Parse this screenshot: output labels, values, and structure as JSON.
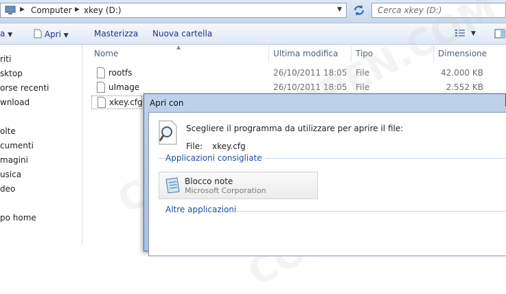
{
  "address": {
    "crumbs": [
      "Computer",
      "xkey (D:)"
    ],
    "search_placeholder": "Cerca xkey (D:)"
  },
  "toolbar": {
    "organize_fragment": "a",
    "open_label": "Apri",
    "burn_label": "Masterizza",
    "new_folder_label": "Nuova cartella"
  },
  "nav": {
    "items": [
      "riti",
      "sktop",
      "orse recenti",
      "wnload",
      "olte",
      "cumenti",
      "magini",
      "usica",
      "deo",
      "po home"
    ]
  },
  "columns": {
    "name": "Nome",
    "modified": "Ultima modifica",
    "type": "Tipo",
    "size": "Dimensione"
  },
  "files": [
    {
      "name": "rootfs",
      "modified": "26/10/2011 18:05",
      "type": "File",
      "size": "42.000 KB"
    },
    {
      "name": "uImage",
      "modified": "26/10/2011 18:05",
      "type": "File",
      "size": "2.552 KB"
    },
    {
      "name": "xkey.cfg",
      "modified": "",
      "type": "",
      "size": ""
    }
  ],
  "dialog": {
    "title": "Apri con",
    "prompt": "Scegliere il programma da utilizzare per aprire il file:",
    "file_label": "File:",
    "file_value": "xkey.cfg",
    "recommended_group": "Applicazioni consigliate",
    "program_name": "Blocco note",
    "program_publisher": "Microsoft Corporation",
    "other_group": "Altre applicazioni"
  },
  "watermark": "CONSOLEOPEN.COM",
  "colors": {
    "link_blue": "#1e4c9c",
    "command_blue": "#1e3287",
    "close_red": "#c9463b"
  }
}
